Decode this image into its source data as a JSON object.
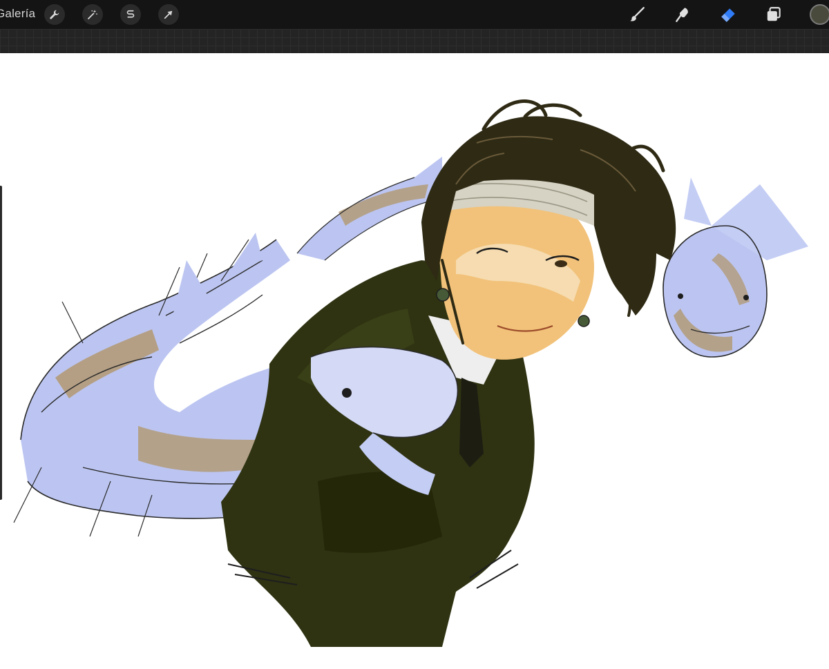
{
  "toolbar": {
    "gallery_label": "Galería",
    "left_tools": [
      {
        "name": "actions",
        "icon": "wrench-icon"
      },
      {
        "name": "adjustments",
        "icon": "magic-wand-icon"
      },
      {
        "name": "selection",
        "icon": "selection-s-icon"
      },
      {
        "name": "transform",
        "icon": "arrow-cursor-icon"
      }
    ],
    "right_tools": [
      {
        "name": "brush",
        "icon": "brush-icon",
        "active": false
      },
      {
        "name": "smudge",
        "icon": "smudge-icon",
        "active": false
      },
      {
        "name": "eraser",
        "icon": "eraser-icon",
        "active": true
      },
      {
        "name": "layers",
        "icon": "layers-icon",
        "active": false
      }
    ],
    "current_color": "#4a4a3c"
  },
  "colors": {
    "toolbar_bg": "#141414",
    "active_tool": "#2f7cf6",
    "hair": "#2e2a14",
    "suit": "#2f3312",
    "skin": "#f2c27a",
    "fish": "#b8c2f0",
    "fish_shadow": "#b29a78"
  }
}
